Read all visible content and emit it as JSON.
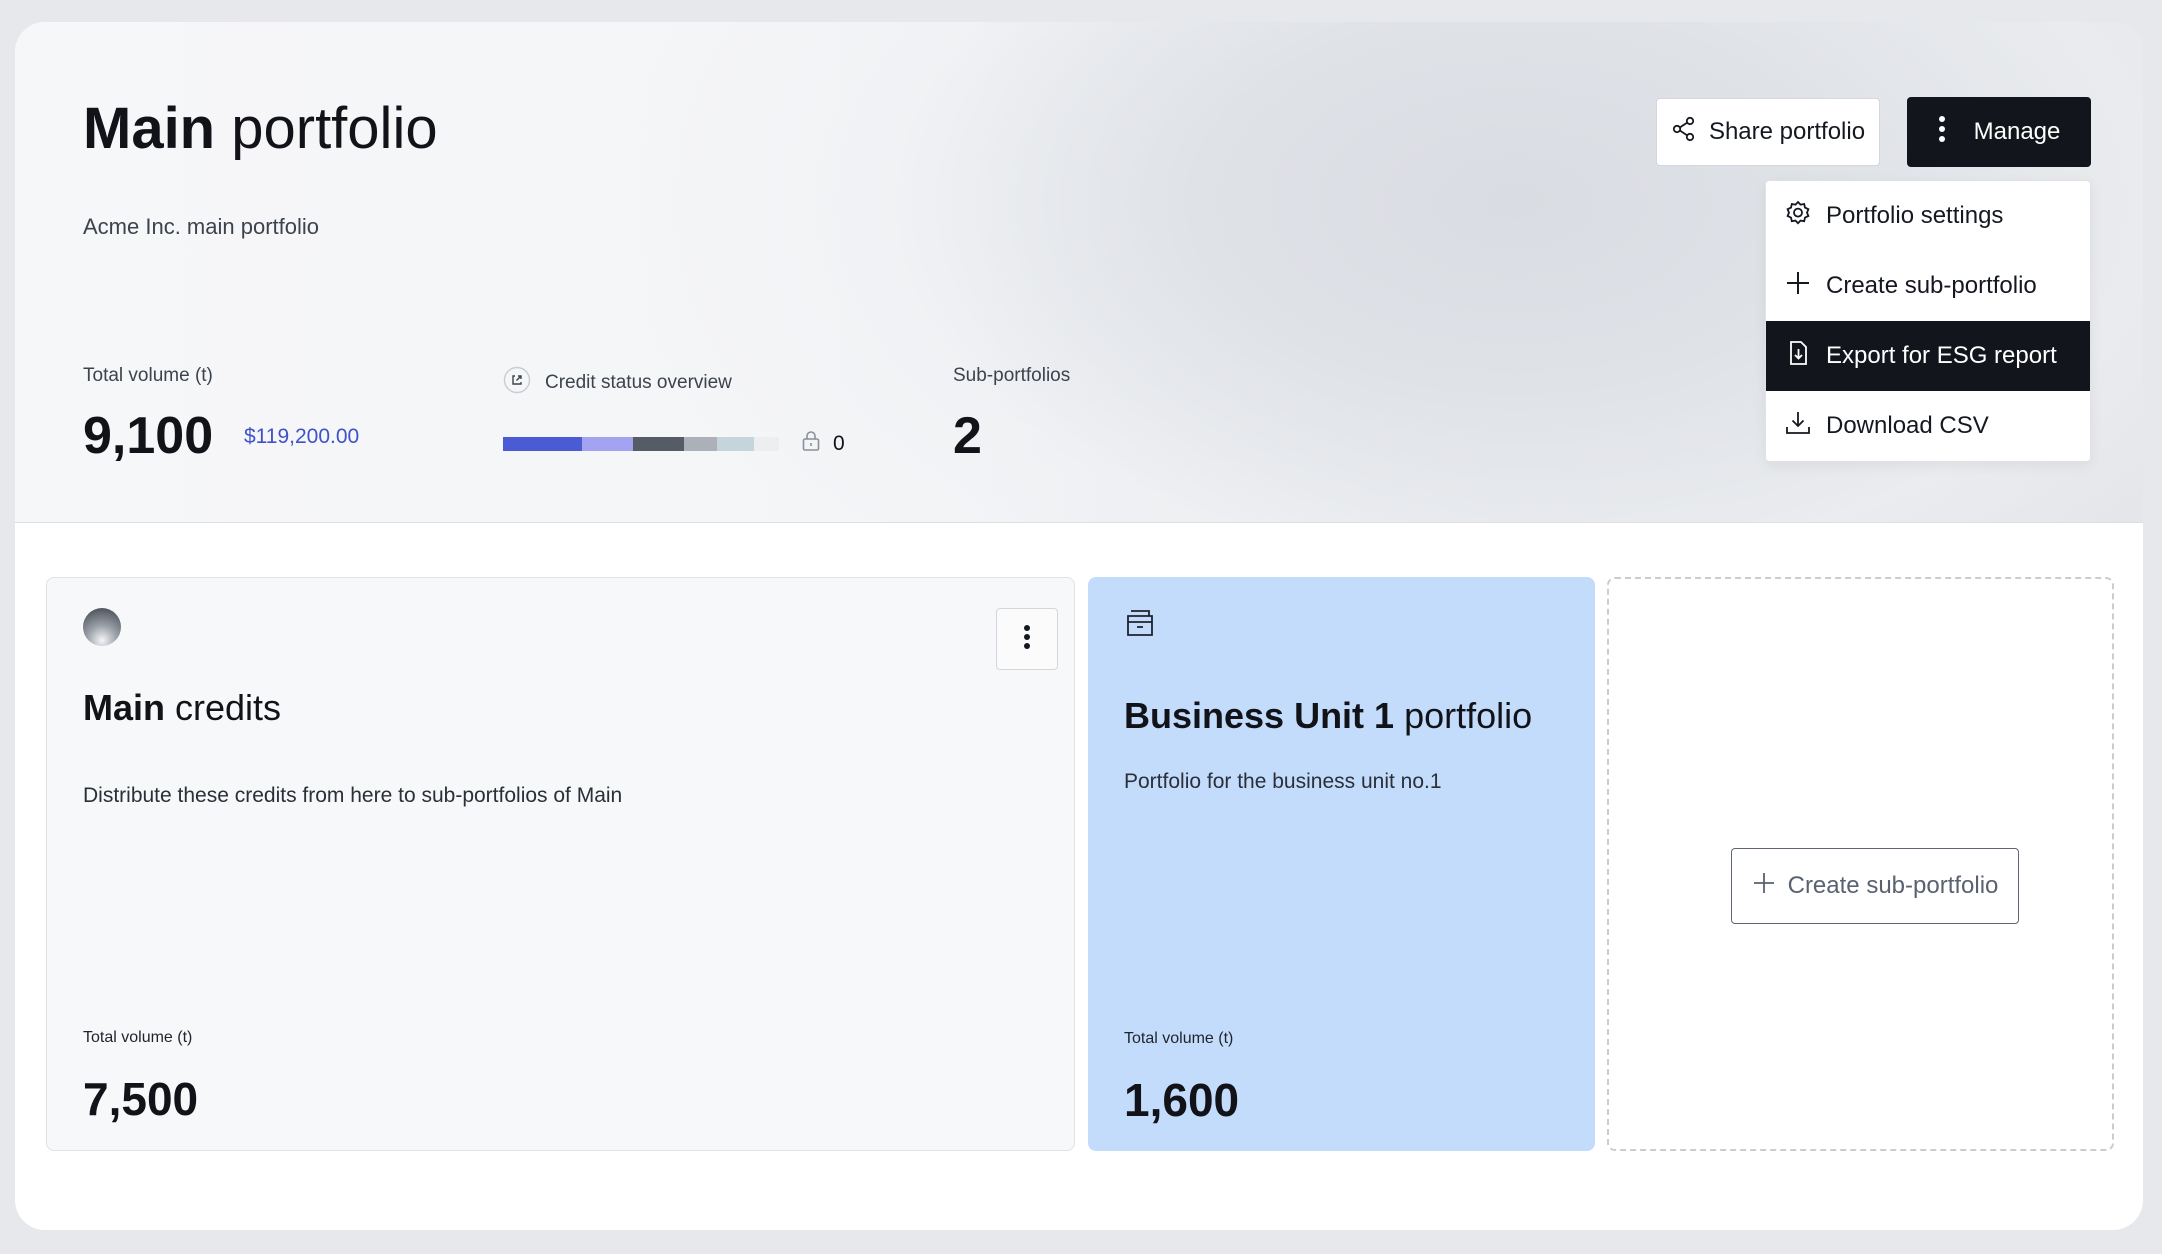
{
  "header": {
    "title_bold": "Main",
    "title_rest": " portfolio",
    "subtitle": "Acme Inc. main portfolio"
  },
  "actions": {
    "share_label": "Share portfolio",
    "manage_label": "Manage"
  },
  "manage_menu": {
    "items": [
      {
        "label": "Portfolio settings",
        "icon": "gear-icon"
      },
      {
        "label": "Create sub-portfolio",
        "icon": "plus-icon"
      },
      {
        "label": "Export for ESG report",
        "icon": "file-download-icon",
        "active": true
      },
      {
        "label": "Download CSV",
        "icon": "download-icon"
      }
    ]
  },
  "stats": {
    "total_volume_label": "Total volume (t)",
    "total_volume": "9,100",
    "total_value": "$119,200.00",
    "credit_status_label": "Credit status overview",
    "credit_status_segments": [
      {
        "share": 0.285,
        "color": "#4b5bd4"
      },
      {
        "share": 0.185,
        "color": "#a4a3f2"
      },
      {
        "share": 0.185,
        "color": "#555c66"
      },
      {
        "share": 0.12,
        "color": "#acb0b8"
      },
      {
        "share": 0.135,
        "color": "#c6d5dc"
      },
      {
        "share": 0.09,
        "color": "#eceef0"
      }
    ],
    "locked_count": "0",
    "sub_portfolios_label": "Sub-portfolios",
    "sub_portfolios_count": "2"
  },
  "cards": {
    "main": {
      "title_bold": "Main",
      "title_rest": " credits",
      "description": "Distribute these credits from here to sub-portfolios of Main",
      "volume_label": "Total volume (t)",
      "volume": "7,500"
    },
    "business_unit": {
      "title_bold": "Business Unit 1",
      "title_rest": " portfolio",
      "description": "Portfolio for the business unit no.1",
      "volume_label": "Total volume (t)",
      "volume": "1,600"
    },
    "add": {
      "button_label": "Create sub-portfolio"
    }
  },
  "colors": {
    "primary_dark": "#12151b",
    "accent_blue": "#3f52c8",
    "sub_card_bg": "#c4dcfc"
  }
}
